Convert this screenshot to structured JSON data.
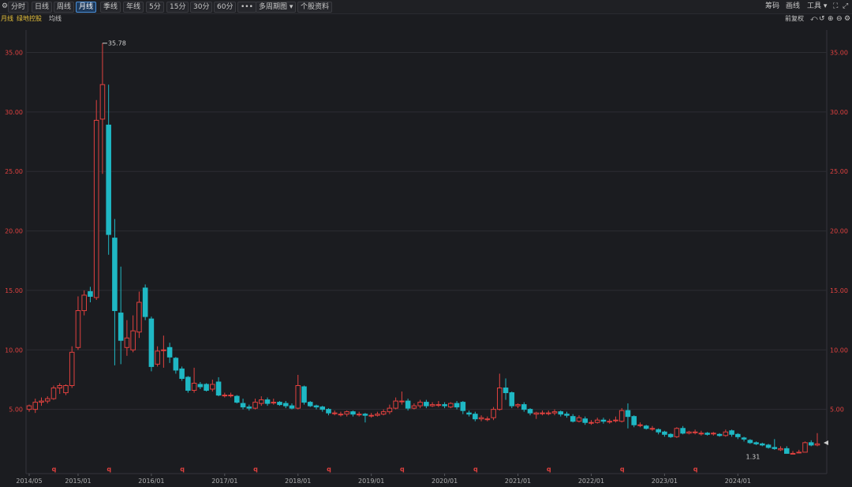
{
  "toolbar": {
    "buttons": [
      "分时",
      "日线",
      "周线",
      "月线",
      "季线",
      "年线",
      "5分",
      "15分",
      "30分",
      "60分",
      "•••",
      "多周期图 ▾",
      "个股资料"
    ],
    "active": "月线",
    "right": [
      "筹码",
      "画线",
      "工具 ▾"
    ]
  },
  "subbar": {
    "period": "月线",
    "name": "绿地控股",
    "indicator": "均线",
    "fq": "前复权"
  },
  "colors": {
    "up": "#e0413f",
    "down": "#1fb8c4",
    "bg": "#1b1c20",
    "grid": "#2c2d33",
    "axis_label": "#e0413f",
    "date_label": "#b0b0b0"
  },
  "chart_data": {
    "type": "candlestick",
    "ylim": [
      0,
      37.5
    ],
    "yticks": [
      "5.00",
      "10.00",
      "15.00",
      "20.00",
      "25.00",
      "30.00",
      "35.00"
    ],
    "xticks": [
      "2014/05",
      "2015/01",
      "2016/01",
      "2017/01",
      "2018/01",
      "2019/01",
      "2020/01",
      "2021/01",
      "2022/01",
      "2023/01",
      "2024/01"
    ],
    "max_label": "35.78",
    "min_label": "1.31",
    "marker": "q",
    "candles": [
      [
        5.0,
        5.3,
        4.8,
        5.4
      ],
      [
        5.0,
        5.6,
        4.7,
        5.9
      ],
      [
        5.6,
        5.7,
        5.3,
        6.0
      ],
      [
        5.7,
        5.9,
        5.5,
        6.1
      ],
      [
        5.9,
        6.8,
        5.8,
        7.0
      ],
      [
        6.8,
        7.0,
        6.3,
        7.2
      ],
      [
        6.4,
        7.0,
        6.2,
        7.1
      ],
      [
        7.0,
        9.8,
        6.8,
        10.3
      ],
      [
        10.2,
        13.3,
        10.0,
        14.5
      ],
      [
        13.3,
        14.6,
        12.9,
        15.0
      ],
      [
        14.9,
        14.5,
        14.0,
        15.3
      ],
      [
        14.4,
        29.3,
        14.2,
        31.0
      ],
      [
        29.4,
        32.3,
        24.8,
        35.78
      ],
      [
        28.9,
        19.7,
        18.0,
        32.3
      ],
      [
        19.4,
        13.3,
        8.7,
        21.0
      ],
      [
        13.1,
        10.8,
        8.8,
        17.0
      ],
      [
        10.2,
        11.0,
        9.5,
        12.5
      ],
      [
        10.0,
        11.6,
        9.8,
        12.9
      ],
      [
        11.5,
        14.0,
        11.0,
        14.9
      ],
      [
        15.2,
        12.8,
        12.5,
        15.5
      ],
      [
        12.6,
        8.6,
        8.2,
        12.8
      ],
      [
        8.8,
        9.9,
        8.6,
        10.3
      ],
      [
        10.0,
        10.0,
        8.5,
        11.2
      ],
      [
        10.2,
        9.4,
        8.9,
        10.6
      ],
      [
        9.3,
        8.3,
        8.0,
        9.4
      ],
      [
        8.4,
        7.6,
        7.4,
        8.6
      ],
      [
        7.7,
        6.6,
        6.4,
        7.8
      ],
      [
        6.6,
        7.2,
        6.4,
        8.5
      ],
      [
        7.1,
        6.9,
        6.7,
        7.3
      ],
      [
        7.1,
        6.6,
        6.5,
        7.2
      ],
      [
        6.7,
        7.1,
        6.5,
        7.5
      ],
      [
        7.3,
        6.2,
        6.1,
        7.7
      ],
      [
        6.2,
        6.2,
        6.0,
        6.4
      ],
      [
        6.2,
        6.2,
        6.0,
        6.4
      ],
      [
        6.1,
        5.6,
        5.5,
        6.2
      ],
      [
        5.5,
        5.2,
        5.0,
        5.9
      ],
      [
        5.2,
        5.1,
        4.9,
        5.4
      ],
      [
        5.1,
        5.6,
        5.0,
        5.9
      ],
      [
        5.5,
        5.8,
        5.3,
        6.1
      ],
      [
        5.8,
        5.5,
        5.3,
        6.0
      ],
      [
        5.6,
        5.6,
        5.4,
        5.9
      ],
      [
        5.6,
        5.4,
        5.3,
        5.7
      ],
      [
        5.5,
        5.3,
        5.1,
        5.7
      ],
      [
        5.3,
        5.1,
        5.0,
        5.5
      ],
      [
        5.1,
        7.0,
        5.0,
        7.9
      ],
      [
        6.9,
        5.6,
        5.4,
        7.0
      ],
      [
        5.6,
        5.3,
        5.2,
        5.7
      ],
      [
        5.3,
        5.2,
        5.0,
        5.4
      ],
      [
        5.2,
        5.0,
        4.8,
        5.3
      ],
      [
        5.0,
        4.7,
        4.5,
        5.1
      ],
      [
        4.7,
        4.7,
        4.5,
        4.9
      ],
      [
        4.6,
        4.6,
        4.4,
        4.8
      ],
      [
        4.6,
        4.8,
        4.4,
        4.9
      ],
      [
        4.8,
        4.6,
        4.4,
        4.9
      ],
      [
        4.6,
        4.6,
        4.4,
        4.8
      ],
      [
        4.6,
        4.5,
        3.9,
        4.7
      ],
      [
        4.5,
        4.5,
        4.3,
        4.7
      ],
      [
        4.5,
        4.6,
        4.4,
        4.8
      ],
      [
        4.6,
        4.8,
        4.5,
        5.0
      ],
      [
        4.8,
        5.1,
        4.6,
        5.4
      ],
      [
        5.1,
        5.7,
        5.0,
        6.0
      ],
      [
        5.7,
        5.7,
        5.4,
        6.5
      ],
      [
        5.7,
        5.1,
        4.9,
        5.9
      ],
      [
        5.1,
        5.3,
        5.0,
        5.5
      ],
      [
        5.3,
        5.6,
        5.1,
        5.8
      ],
      [
        5.6,
        5.3,
        5.1,
        5.8
      ],
      [
        5.3,
        5.4,
        5.2,
        5.6
      ],
      [
        5.4,
        5.4,
        5.2,
        5.7
      ],
      [
        5.4,
        5.3,
        5.1,
        5.6
      ],
      [
        5.2,
        5.5,
        5.1,
        5.6
      ],
      [
        5.5,
        5.2,
        5.0,
        5.7
      ],
      [
        5.6,
        4.9,
        4.6,
        5.7
      ],
      [
        4.7,
        4.6,
        4.4,
        4.9
      ],
      [
        4.6,
        4.2,
        4.0,
        4.8
      ],
      [
        4.2,
        4.3,
        4.0,
        4.5
      ],
      [
        4.2,
        4.2,
        4.0,
        4.4
      ],
      [
        4.3,
        5.0,
        4.1,
        5.2
      ],
      [
        5.0,
        6.8,
        4.9,
        8.0
      ],
      [
        6.8,
        6.4,
        5.8,
        7.6
      ],
      [
        6.4,
        5.3,
        5.1,
        6.5
      ],
      [
        5.3,
        5.4,
        5.1,
        5.5
      ],
      [
        5.4,
        5.0,
        4.8,
        5.6
      ],
      [
        5.0,
        4.7,
        4.5,
        5.1
      ],
      [
        4.6,
        4.7,
        4.2,
        4.8
      ],
      [
        4.7,
        4.7,
        4.5,
        4.9
      ],
      [
        4.7,
        4.7,
        4.5,
        4.9
      ],
      [
        4.7,
        4.8,
        4.5,
        5.0
      ],
      [
        4.8,
        4.6,
        4.4,
        4.9
      ],
      [
        4.6,
        4.5,
        4.3,
        4.8
      ],
      [
        4.4,
        4.0,
        3.9,
        4.6
      ],
      [
        4.0,
        4.3,
        3.9,
        4.5
      ],
      [
        4.2,
        3.9,
        3.7,
        4.4
      ],
      [
        3.9,
        3.9,
        3.7,
        4.1
      ],
      [
        3.9,
        4.1,
        3.8,
        4.3
      ],
      [
        4.1,
        4.0,
        3.8,
        4.3
      ],
      [
        4.0,
        4.0,
        3.8,
        4.2
      ],
      [
        4.1,
        4.1,
        3.9,
        4.4
      ],
      [
        4.0,
        4.9,
        3.9,
        5.1
      ],
      [
        4.9,
        4.4,
        3.4,
        5.5
      ],
      [
        4.4,
        3.7,
        3.5,
        4.5
      ],
      [
        3.7,
        3.7,
        3.5,
        3.9
      ],
      [
        3.6,
        3.4,
        3.3,
        3.7
      ],
      [
        3.4,
        3.4,
        3.2,
        3.6
      ],
      [
        3.3,
        3.1,
        2.9,
        3.4
      ],
      [
        3.1,
        2.9,
        2.7,
        3.2
      ],
      [
        2.9,
        2.7,
        2.6,
        3.0
      ],
      [
        2.7,
        3.4,
        2.6,
        3.5
      ],
      [
        3.4,
        3.0,
        2.9,
        3.6
      ],
      [
        3.0,
        3.1,
        2.9,
        3.2
      ],
      [
        3.1,
        3.1,
        2.9,
        3.3
      ],
      [
        3.0,
        3.0,
        2.8,
        3.2
      ],
      [
        3.0,
        2.9,
        2.8,
        3.1
      ],
      [
        3.0,
        3.0,
        2.8,
        3.1
      ],
      [
        2.9,
        2.8,
        2.7,
        3.0
      ],
      [
        2.8,
        3.1,
        2.7,
        3.3
      ],
      [
        3.2,
        2.9,
        2.7,
        3.3
      ],
      [
        2.9,
        2.7,
        2.5,
        3.0
      ],
      [
        2.6,
        2.5,
        2.3,
        2.7
      ],
      [
        2.4,
        2.2,
        2.1,
        2.5
      ],
      [
        2.2,
        2.1,
        2.0,
        2.3
      ],
      [
        2.1,
        2.0,
        1.9,
        2.2
      ],
      [
        2.0,
        1.8,
        1.7,
        2.1
      ],
      [
        1.8,
        1.7,
        1.6,
        2.5
      ],
      [
        1.6,
        1.7,
        1.5,
        1.9
      ],
      [
        1.7,
        1.3,
        1.31,
        1.9
      ],
      [
        1.3,
        1.3,
        1.3,
        1.5
      ],
      [
        1.4,
        1.4,
        1.3,
        1.6
      ],
      [
        1.4,
        2.2,
        1.4,
        2.3
      ],
      [
        2.2,
        2.0,
        1.9,
        2.4
      ],
      [
        2.0,
        2.1,
        1.9,
        3.0
      ]
    ]
  }
}
